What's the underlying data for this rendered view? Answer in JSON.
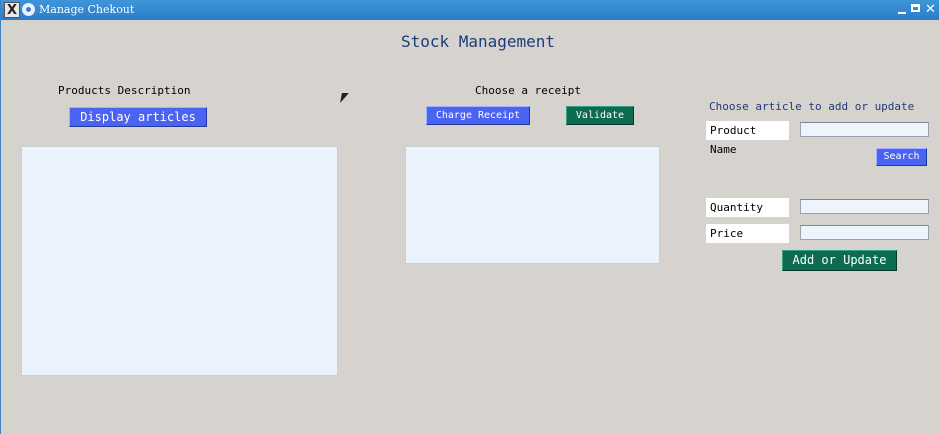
{
  "window": {
    "title": "Manage Chekout",
    "controls": {
      "minimize": "minimize-icon",
      "maximize": "maximize-icon",
      "close": "close-icon",
      "close_glyph": "✕"
    }
  },
  "page": {
    "heading": "Stock Management"
  },
  "products": {
    "label": "Products Description",
    "display_button": "Display articles"
  },
  "receipt": {
    "label": "Choose a receipt",
    "charge_button": "Charge Receipt",
    "validate_button": "Validate"
  },
  "article_form": {
    "label": "Choose article to add or update",
    "product_name_label": "Product Name",
    "product_name_value": "",
    "search_button": "Search",
    "quantity_label": "Quantity",
    "quantity_value": "",
    "price_label": "Price",
    "price_value": "",
    "add_update_button": "Add or Update"
  },
  "colors": {
    "titlebar": "#2a7cc8",
    "background": "#d6d2cd",
    "blue_button": "#4a63f2",
    "green_button": "#0d6b52",
    "heading_text": "#1e3c78",
    "panel": "#eaf2fc"
  }
}
